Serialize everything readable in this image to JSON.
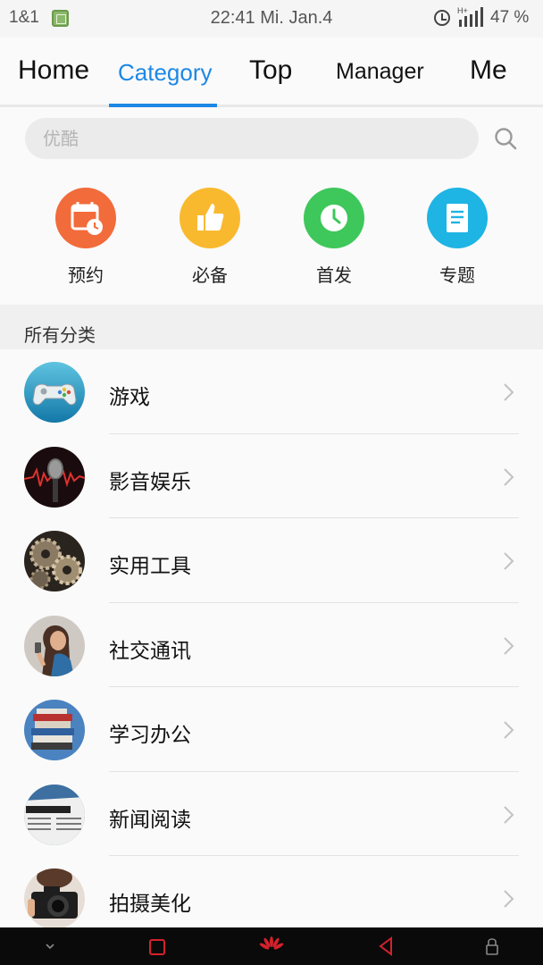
{
  "status_bar": {
    "carrier": "1&1",
    "clock": "22:41 Mi. Jan.4",
    "network": "H+",
    "battery": "47 %"
  },
  "tabs": [
    {
      "label": "Home",
      "active": false
    },
    {
      "label": "Category",
      "active": true
    },
    {
      "label": "Top",
      "active": false
    },
    {
      "label": "Manager",
      "active": false
    },
    {
      "label": "Me",
      "active": false
    }
  ],
  "search": {
    "placeholder": "优酷",
    "icon": "search-icon"
  },
  "quick_links": [
    {
      "label": "预约",
      "color": "#f26b3a",
      "icon": "calendar-clock-icon"
    },
    {
      "label": "必备",
      "color": "#f9b92f",
      "icon": "thumbs-up-icon"
    },
    {
      "label": "首发",
      "color": "#3ec75a",
      "icon": "clock-icon"
    },
    {
      "label": "专题",
      "color": "#1eb4e3",
      "icon": "document-icon"
    }
  ],
  "section_title": "所有分类",
  "categories": [
    {
      "label": "游戏",
      "icon": "gamepad-icon"
    },
    {
      "label": "影音娱乐",
      "icon": "microphone-icon"
    },
    {
      "label": "实用工具",
      "icon": "gears-icon"
    },
    {
      "label": "社交通讯",
      "icon": "person-phone-icon"
    },
    {
      "label": "学习办公",
      "icon": "books-icon"
    },
    {
      "label": "新闻阅读",
      "icon": "newspaper-icon"
    },
    {
      "label": "拍摄美化",
      "icon": "camera-icon"
    }
  ],
  "accent_color": "#1e88e5"
}
